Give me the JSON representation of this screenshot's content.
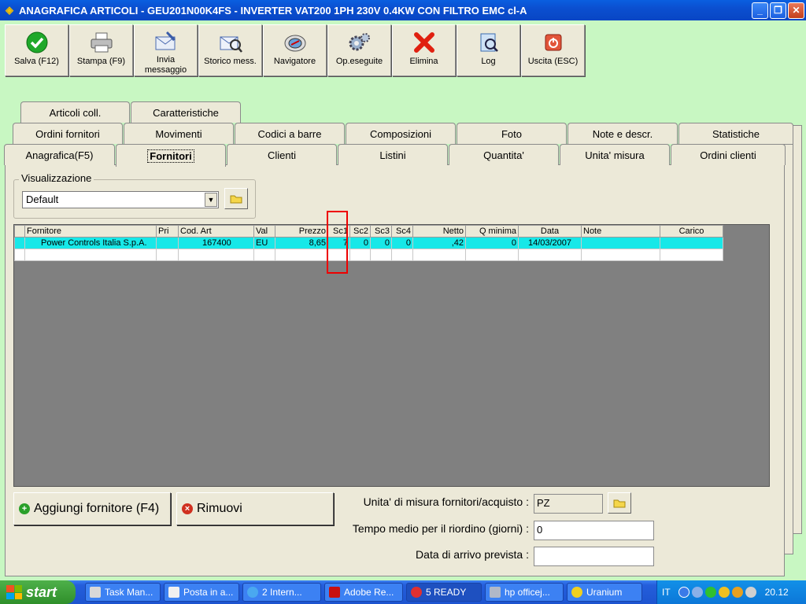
{
  "window": {
    "title": "ANAGRAFICA ARTICOLI - GEU201N00K4FS - INVERTER  VAT200 1PH 230V 0.4KW CON FILTRO EMC cl-A",
    "min": "_",
    "max": "❐",
    "close": "✕"
  },
  "toolbar": [
    {
      "label": "Salva (F12)",
      "icon": "save-check-icon"
    },
    {
      "label": "Stampa (F9)",
      "icon": "printer-icon"
    },
    {
      "label": "Invia\nmessaggio",
      "icon": "send-message-icon"
    },
    {
      "label": "Storico mess.",
      "icon": "message-history-icon"
    },
    {
      "label": "Navigatore",
      "icon": "navigator-icon"
    },
    {
      "label": "Op.eseguite",
      "icon": "gears-icon"
    },
    {
      "label": "Elimina",
      "icon": "delete-x-icon"
    },
    {
      "label": "Log",
      "icon": "log-icon"
    },
    {
      "label": "Uscita (ESC)",
      "icon": "exit-icon"
    }
  ],
  "tabs": {
    "row1": [
      "Articoli coll.",
      "Caratteristiche"
    ],
    "row2": [
      "Ordini fornitori",
      "Movimenti",
      "Codici a barre",
      "Composizioni",
      "Foto",
      "Note e descr.",
      "Statistiche"
    ],
    "row3": [
      "Anagrafica(F5)",
      "Fornitori",
      "Clienti",
      "Listini",
      "Quantita'",
      "Unita' misura",
      "Ordini clienti"
    ],
    "active": "Fornitori"
  },
  "view": {
    "group_label": "Visualizzazione",
    "selected": "Default"
  },
  "grid": {
    "columns": [
      "Fornitore",
      "Pri",
      "Cod. Art",
      "Val",
      "Prezzo",
      "Sc1",
      "Sc2",
      "Sc3",
      "Sc4",
      "Netto",
      "Q minima",
      "Data",
      "Note",
      "Carico"
    ],
    "rows": [
      [
        "Power Controls Italia S.p.A.",
        "",
        "167400",
        "EU",
        "8,65",
        "7",
        "0",
        "0",
        "0",
        ",42",
        "0",
        "14/03/2007",
        "",
        ""
      ],
      [
        "",
        "",
        "",
        "",
        "",
        "",
        "",
        "",
        "",
        "",
        "",
        "",
        "",
        ""
      ]
    ]
  },
  "buttons": {
    "add": "Aggiungi fornitore (F4)",
    "remove": "Rimuovi"
  },
  "fields": {
    "uom_label": "Unita' di misura fornitori/acquisto :",
    "uom_value": "PZ",
    "reorder_label": "Tempo medio per il riordino (giorni) :",
    "reorder_value": "0",
    "arrival_label": "Data di arrivo prevista :",
    "arrival_value": ""
  },
  "taskbar": {
    "start": "start",
    "tasks": [
      "Task Man...",
      "Posta in a...",
      "2 Intern...",
      "Adobe Re...",
      "5 READY",
      "hp officej...",
      "Uranium"
    ],
    "lang": "IT",
    "clock": "20.12"
  },
  "colors": {
    "selected_row": "#17e8e8",
    "highlight_box": "#e00000",
    "titlebar": "#0b4fd0",
    "background": "#c8f7c2"
  }
}
